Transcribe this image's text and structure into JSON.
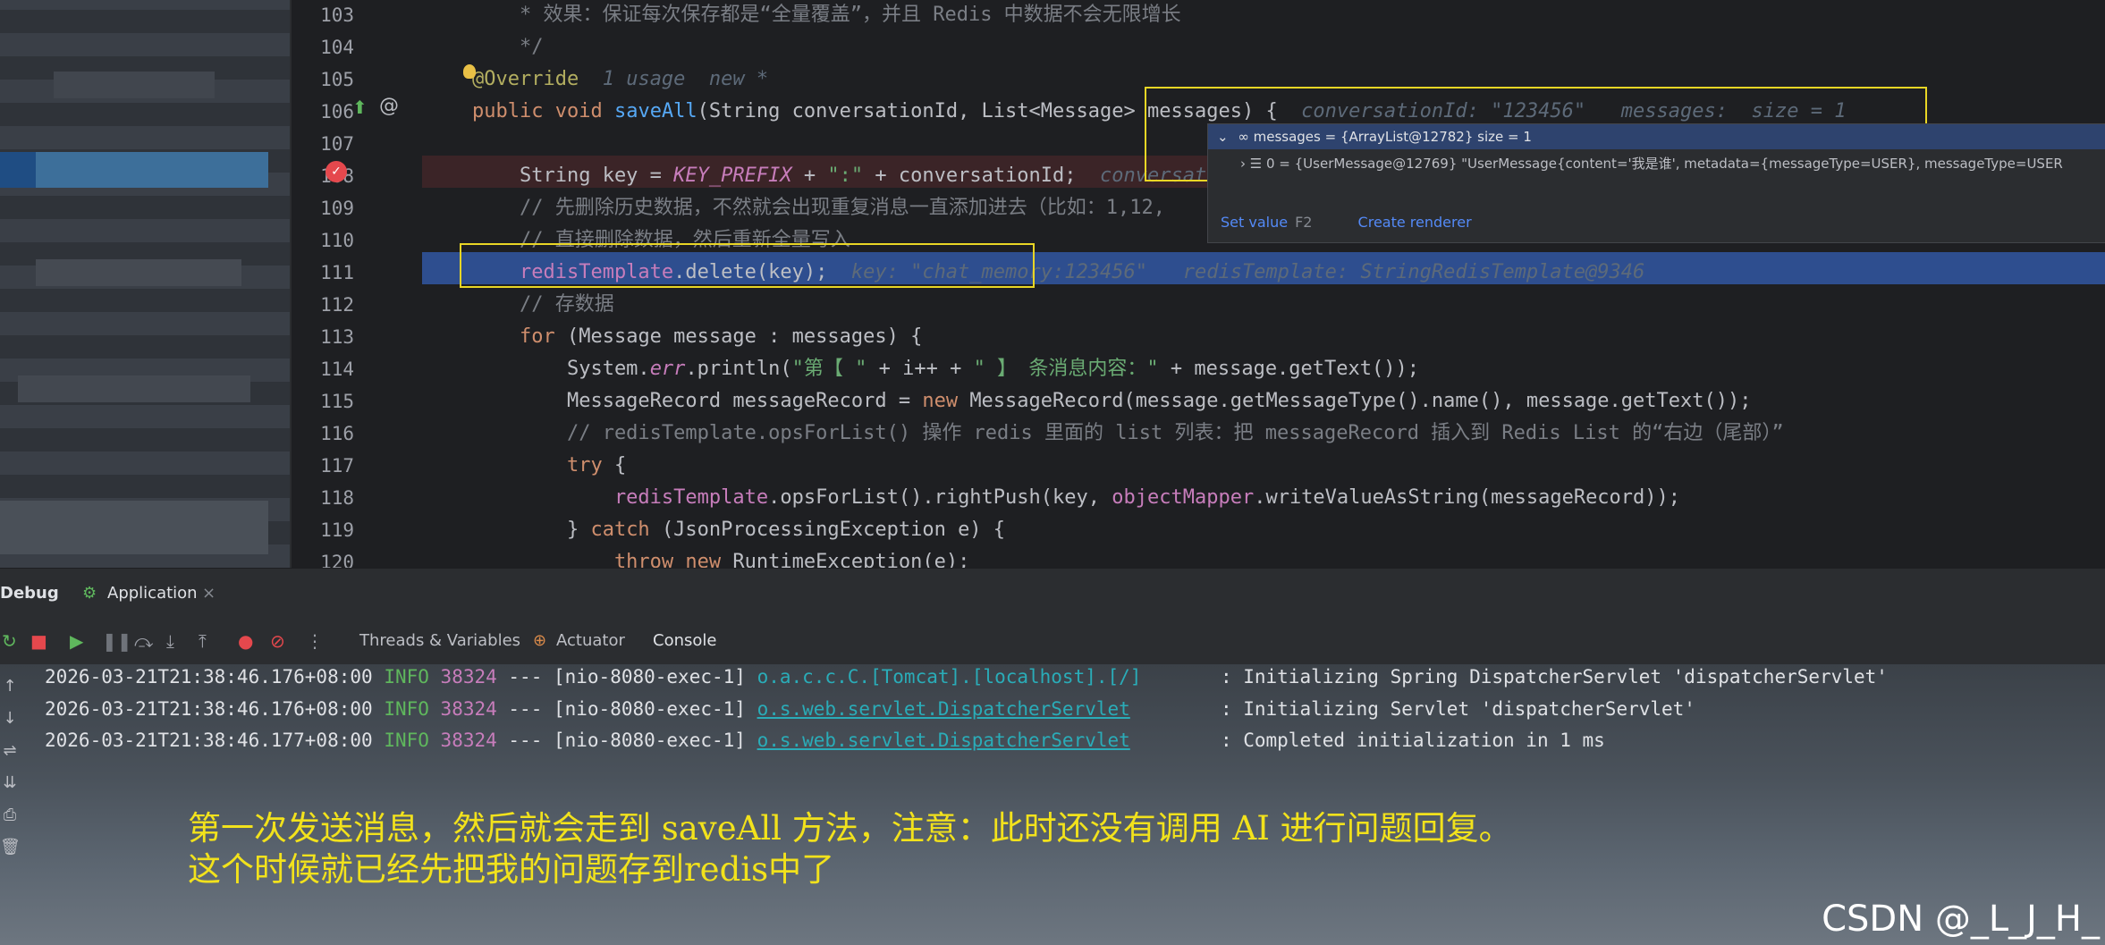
{
  "editor": {
    "lines": [
      {
        "n": "103",
        "parts": [
          [
            "cm",
            "    * 效果：保证每次保存都是“全量覆盖”，并且 Redis 中数据不会无限增长"
          ]
        ]
      },
      {
        "n": "104",
        "parts": [
          [
            "cm",
            "    */"
          ]
        ]
      },
      {
        "n": "105",
        "parts": [
          [
            "ann",
            "@Override"
          ],
          [
            "hint",
            "  1 usage  new *"
          ]
        ]
      },
      {
        "n": "106",
        "parts": [
          [
            "kw",
            "public void "
          ],
          [
            "fn",
            "saveAll"
          ],
          [
            "",
            "(String conversationId, List<Message> messages) {"
          ],
          [
            "hint",
            "  conversationId: \"123456\"   messages:  size = 1"
          ]
        ]
      },
      {
        "n": "107",
        "parts": [
          [
            "",
            ""
          ]
        ]
      },
      {
        "n": "108",
        "parts": [
          [
            "",
            "    String key = "
          ],
          [
            "const",
            "KEY_PREFIX"
          ],
          [
            "",
            " + "
          ],
          [
            "str",
            "\":\""
          ],
          [
            "",
            " + conversationId;"
          ],
          [
            "hint",
            "  conversat"
          ]
        ]
      },
      {
        "n": "109",
        "parts": [
          [
            "cm",
            "    // 先删除历史数据，不然就会出现重复消息一直添加进去（比如：1,12,"
          ]
        ]
      },
      {
        "n": "110",
        "parts": [
          [
            "cm",
            "    // 直接删除数据，然后重新全量写入"
          ]
        ]
      },
      {
        "n": "111",
        "parts": [
          [
            "field",
            "    redisTemplate"
          ],
          [
            "",
            ".delete(key);"
          ],
          [
            "hint",
            "  key: \"chat_memory:123456\"   redisTemplate: StringRedisTemplate@9346"
          ]
        ]
      },
      {
        "n": "112",
        "parts": [
          [
            "cm",
            "    // 存数据"
          ]
        ]
      },
      {
        "n": "113",
        "parts": [
          [
            "kw",
            "    for "
          ],
          [
            "",
            "(Message message : messages) {"
          ]
        ]
      },
      {
        "n": "114",
        "parts": [
          [
            "",
            "        System."
          ],
          [
            "const",
            "err"
          ],
          [
            "",
            ".println("
          ],
          [
            "str",
            "\"第【 \""
          ],
          [
            "",
            " + i++ + "
          ],
          [
            "str",
            "\" 】 条消息内容：\""
          ],
          [
            "",
            " + message.getText());"
          ]
        ]
      },
      {
        "n": "115",
        "parts": [
          [
            "",
            "        MessageRecord messageRecord = "
          ],
          [
            "kw",
            "new "
          ],
          [
            "",
            "MessageRecord(message.getMessageType().name(), message.getText());"
          ]
        ]
      },
      {
        "n": "116",
        "parts": [
          [
            "cm",
            "        // redisTemplate.opsForList() 操作 redis 里面的 list 列表：把 messageRecord 插入到 Redis List 的“右边（尾部）”"
          ]
        ]
      },
      {
        "n": "117",
        "parts": [
          [
            "kw",
            "        try "
          ],
          [
            "",
            "{"
          ]
        ]
      },
      {
        "n": "118",
        "parts": [
          [
            "field",
            "            redisTemplate"
          ],
          [
            "",
            ".opsForList().rightPush(key, "
          ],
          [
            "field",
            "objectMapper"
          ],
          [
            "",
            ".writeValueAsString(messageRecord));"
          ]
        ]
      },
      {
        "n": "119",
        "parts": [
          [
            "",
            "        } "
          ],
          [
            "kw",
            "catch "
          ],
          [
            "",
            "(JsonProcessingException e) {"
          ]
        ]
      },
      {
        "n": "120",
        "parts": [
          [
            "kw",
            "            throw new "
          ],
          [
            "",
            "RuntimeException(e);"
          ]
        ]
      }
    ]
  },
  "popup": {
    "row1": "∞ messages = {ArrayList@12782}  size = 1",
    "row2": "› ☰ 0 = {UserMessage@12769} \"UserMessage{content='我是谁', metadata={messageType=USER}, messageType=USER",
    "set_value": "Set value",
    "set_value_key": "F2",
    "create_renderer": "Create renderer"
  },
  "debug": {
    "tab_debug": "Debug",
    "tab_app": "Application",
    "close": "×",
    "tools": {
      "threads": "Threads & Variables",
      "actuator": "Actuator",
      "console": "Console"
    }
  },
  "console": {
    "lines": [
      {
        "ts": "2026-03-21T21:38:46.176+08:00",
        "lvl": "INFO",
        "pid": "38324",
        "thread": " --- [nio-8080-exec-1] ",
        "logger": "o.a.c.c.C.[Tomcat].[localhost].[/]",
        "msg": "       : Initializing Spring DispatcherServlet 'dispatcherServlet'"
      },
      {
        "ts": "2026-03-21T21:38:46.176+08:00",
        "lvl": "INFO",
        "pid": "38324",
        "thread": " --- [nio-8080-exec-1] ",
        "logger": "o.s.web.servlet.DispatcherServlet",
        "msg": "        : Initializing Servlet 'dispatcherServlet'"
      },
      {
        "ts": "2026-03-21T21:38:46.177+08:00",
        "lvl": "INFO",
        "pid": "38324",
        "thread": " --- [nio-8080-exec-1] ",
        "logger": "o.s.web.servlet.DispatcherServlet",
        "msg": "        : Completed initialization in 1 ms"
      }
    ]
  },
  "caption": {
    "line1": "第一次发送消息，然后就会走到 saveAll 方法，注意：此时还没有调用 AI 进行问题回复。",
    "line2": "这个时候就已经先把我的问题存到redis中了"
  },
  "watermark": "CSDN @_L_J_H_",
  "colors": {
    "accent_box": "#e9d625",
    "current_line": "#2e4e8f",
    "breakpoint": "#e5484d"
  }
}
